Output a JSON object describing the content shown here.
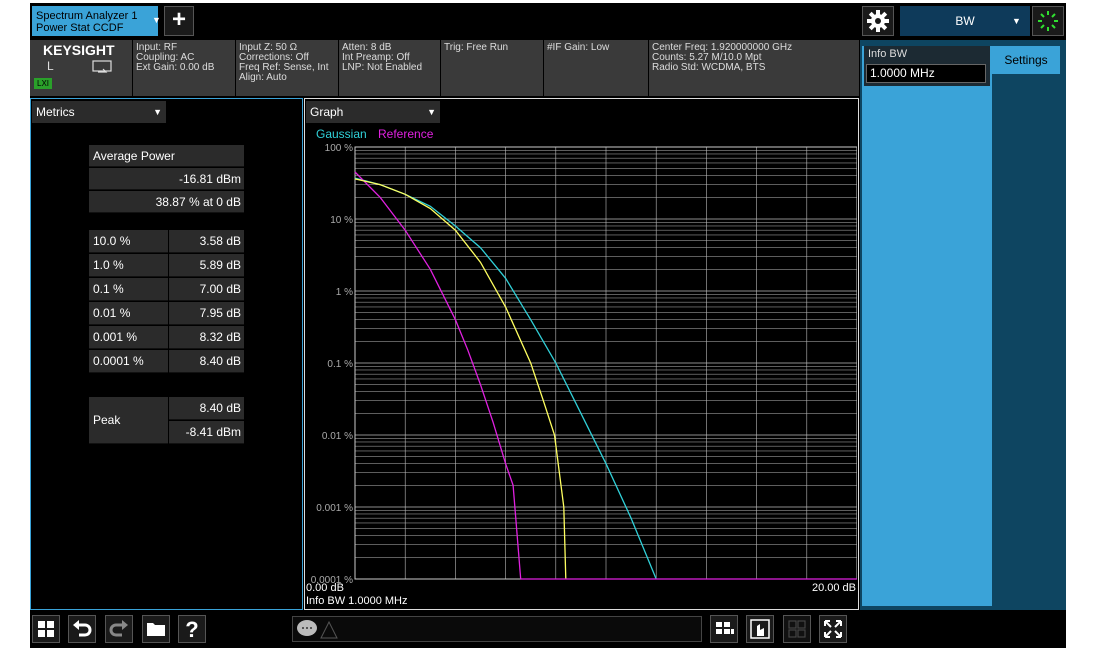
{
  "tab": {
    "line1": "Spectrum Analyzer 1",
    "line2": "Power Stat CCDF"
  },
  "menu": {
    "selected": "BW"
  },
  "status": {
    "brand": "KEYSIGHT",
    "l_indicator": "L",
    "lxi": "LXI",
    "input_col": [
      "Input: RF",
      "Coupling: AC",
      "Ext Gain: 0.00 dB"
    ],
    "inputz_col": [
      "Input Z: 50 Ω",
      "Corrections: Off",
      "Freq Ref: Sense, Int",
      "Align: Auto"
    ],
    "atten_col": [
      "Atten: 8 dB",
      "Int Preamp: Off",
      "LNP: Not Enabled"
    ],
    "trig": "Trig: Free Run",
    "ifgain": "#IF Gain: Low",
    "center_col": [
      "Center Freq: 1.920000000 GHz",
      "Counts: 5.27 M/10.0 Mpt",
      "Radio Std: WCDMA, BTS"
    ]
  },
  "metrics": {
    "dropdown": "Metrics",
    "avg_power_label": "Average Power",
    "avg_power_dbm": "-16.81 dBm",
    "avg_power_pct": "38.87 % at 0 dB",
    "rows": [
      {
        "pct": "10.0 %",
        "db": "3.58 dB"
      },
      {
        "pct": "1.0 %",
        "db": "5.89 dB"
      },
      {
        "pct": "0.1 %",
        "db": "7.00 dB"
      },
      {
        "pct": "0.01 %",
        "db": "7.95 dB"
      },
      {
        "pct": "0.001 %",
        "db": "8.32 dB"
      },
      {
        "pct": "0.0001 %",
        "db": "8.40 dB"
      }
    ],
    "peak_label": "Peak",
    "peak_db": "8.40 dB",
    "peak_dbm": "-8.41 dBm"
  },
  "graph": {
    "dropdown": "Graph",
    "legend_gaussian": "Gaussian",
    "legend_reference": "Reference",
    "x_start": "0.00 dB",
    "x_end": "20.00 dB",
    "info_bw": "Info BW 1.0000 MHz"
  },
  "settings": {
    "info_bw_label": "Info BW",
    "info_bw_value": "1.0000 MHz",
    "tab_label": "Settings"
  },
  "colors": {
    "accent": "#3aa3d8",
    "gaussian": "#30d0d8",
    "reference": "#e020e0",
    "trace": "#ffff60"
  },
  "chart_data": {
    "type": "line",
    "x_range_db": [
      0,
      20
    ],
    "y_log_range_pct": [
      0.0001,
      100
    ],
    "y_tick_labels": [
      "100 %",
      "10 %",
      "1 %",
      "0.1 %",
      "0.01 %",
      "0.001 %",
      "0.0001 %"
    ],
    "series": [
      {
        "name": "Gaussian",
        "x_db": [
          0,
          1,
          2,
          3,
          4,
          5,
          6,
          7,
          8,
          9,
          10,
          11,
          12
        ],
        "y_pct": [
          37,
          30,
          22,
          15,
          8,
          4,
          1.5,
          0.4,
          0.1,
          0.02,
          0.004,
          0.0007,
          0.0001
        ]
      },
      {
        "name": "Reference",
        "x_db": [
          0,
          1,
          2,
          3,
          4,
          4.5,
          5,
          5.5,
          6,
          6.3,
          6.6
        ],
        "y_pct": [
          45,
          20,
          7,
          2,
          0.4,
          0.15,
          0.05,
          0.015,
          0.004,
          0.002,
          0.0001
        ]
      },
      {
        "x_db": [
          0,
          1,
          2,
          3,
          4,
          5,
          6,
          7,
          7.5,
          7.95,
          8.32,
          8.4
        ],
        "y_pct": [
          36,
          30,
          22,
          14,
          7,
          2.5,
          0.6,
          0.1,
          0.03,
          0.01,
          0.001,
          0.0001
        ]
      }
    ]
  }
}
